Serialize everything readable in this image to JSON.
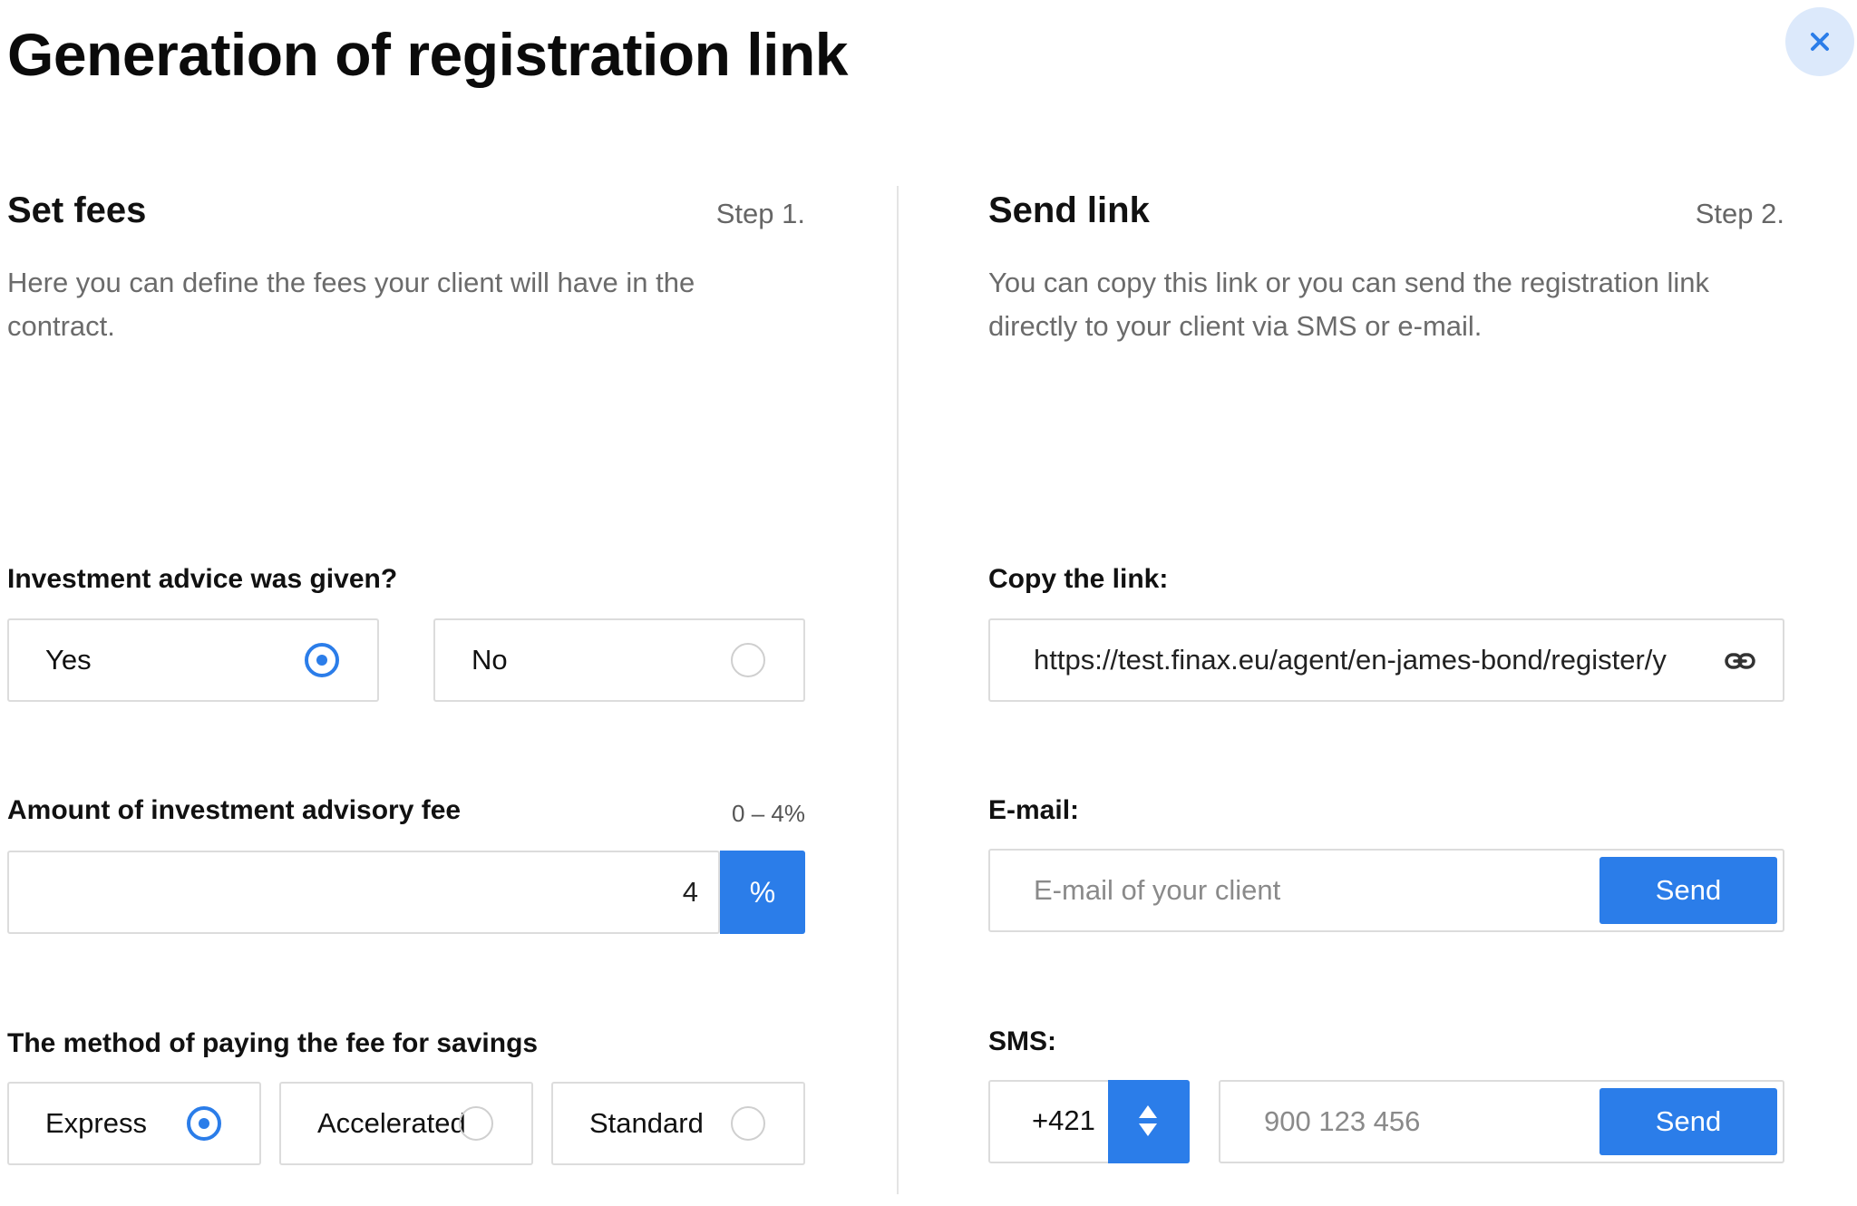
{
  "page": {
    "title": "Generation of registration link",
    "close_icon": "close-icon"
  },
  "colors": {
    "accent": "#2b7de9",
    "close_bg": "#dce9fb",
    "border": "#dcdcdc",
    "muted_text": "#6b6b6b"
  },
  "left": {
    "title": "Set fees",
    "step": "Step 1.",
    "description": "Here you can define the fees your client will have in the contract.",
    "advice": {
      "label": "Investment advice was given?",
      "options": [
        {
          "label": "Yes",
          "selected": true
        },
        {
          "label": "No",
          "selected": false
        }
      ]
    },
    "fee": {
      "label": "Amount of investment advisory fee",
      "range": "0 – 4%",
      "value": "4",
      "unit": "%"
    },
    "method": {
      "label": "The method of paying the fee for savings",
      "options": [
        {
          "label": "Express",
          "selected": true
        },
        {
          "label": "Accelerated",
          "selected": false
        },
        {
          "label": "Standard",
          "selected": false
        }
      ]
    }
  },
  "right": {
    "title": "Send link",
    "step": "Step 2.",
    "description": "You can copy this link or you can send the registration link directly to your client via SMS or e-mail.",
    "copy": {
      "label": "Copy the link:",
      "value": "https://test.finax.eu/agent/en-james-bond/register/y",
      "icon": "link-icon"
    },
    "email": {
      "label": "E-mail:",
      "placeholder": "E-mail of your client",
      "button": "Send"
    },
    "sms": {
      "label": "SMS:",
      "prefix": "+421",
      "prefix_icon": "sort-arrows-icon",
      "placeholder": "900 123 456",
      "button": "Send"
    }
  }
}
